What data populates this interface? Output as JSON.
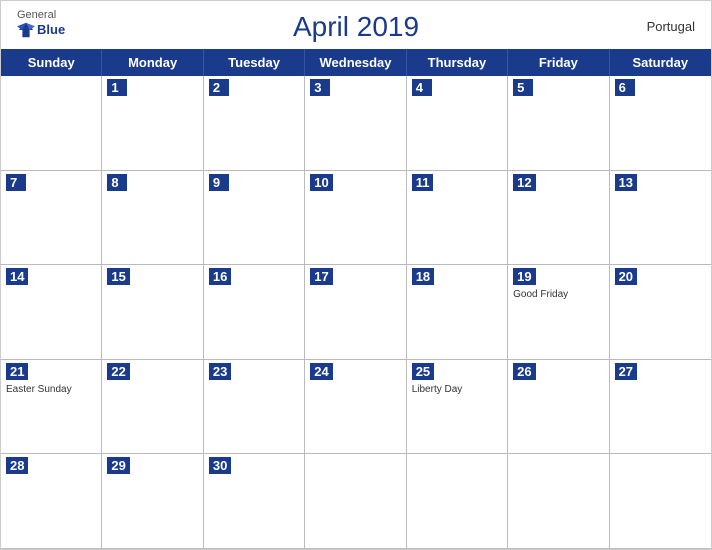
{
  "header": {
    "title": "April 2019",
    "country": "Portugal",
    "logo": {
      "general": "General",
      "blue": "Blue"
    }
  },
  "days": {
    "headers": [
      "Sunday",
      "Monday",
      "Tuesday",
      "Wednesday",
      "Thursday",
      "Friday",
      "Saturday"
    ]
  },
  "weeks": [
    [
      {
        "date": "",
        "event": ""
      },
      {
        "date": "1",
        "event": ""
      },
      {
        "date": "2",
        "event": ""
      },
      {
        "date": "3",
        "event": ""
      },
      {
        "date": "4",
        "event": ""
      },
      {
        "date": "5",
        "event": ""
      },
      {
        "date": "6",
        "event": ""
      }
    ],
    [
      {
        "date": "7",
        "event": ""
      },
      {
        "date": "8",
        "event": ""
      },
      {
        "date": "9",
        "event": ""
      },
      {
        "date": "10",
        "event": ""
      },
      {
        "date": "11",
        "event": ""
      },
      {
        "date": "12",
        "event": ""
      },
      {
        "date": "13",
        "event": ""
      }
    ],
    [
      {
        "date": "14",
        "event": ""
      },
      {
        "date": "15",
        "event": ""
      },
      {
        "date": "16",
        "event": ""
      },
      {
        "date": "17",
        "event": ""
      },
      {
        "date": "18",
        "event": ""
      },
      {
        "date": "19",
        "event": "Good Friday"
      },
      {
        "date": "20",
        "event": ""
      }
    ],
    [
      {
        "date": "21",
        "event": "Easter Sunday"
      },
      {
        "date": "22",
        "event": ""
      },
      {
        "date": "23",
        "event": ""
      },
      {
        "date": "24",
        "event": ""
      },
      {
        "date": "25",
        "event": "Liberty Day"
      },
      {
        "date": "26",
        "event": ""
      },
      {
        "date": "27",
        "event": ""
      }
    ],
    [
      {
        "date": "28",
        "event": ""
      },
      {
        "date": "29",
        "event": ""
      },
      {
        "date": "30",
        "event": ""
      },
      {
        "date": "",
        "event": ""
      },
      {
        "date": "",
        "event": ""
      },
      {
        "date": "",
        "event": ""
      },
      {
        "date": "",
        "event": ""
      }
    ]
  ]
}
